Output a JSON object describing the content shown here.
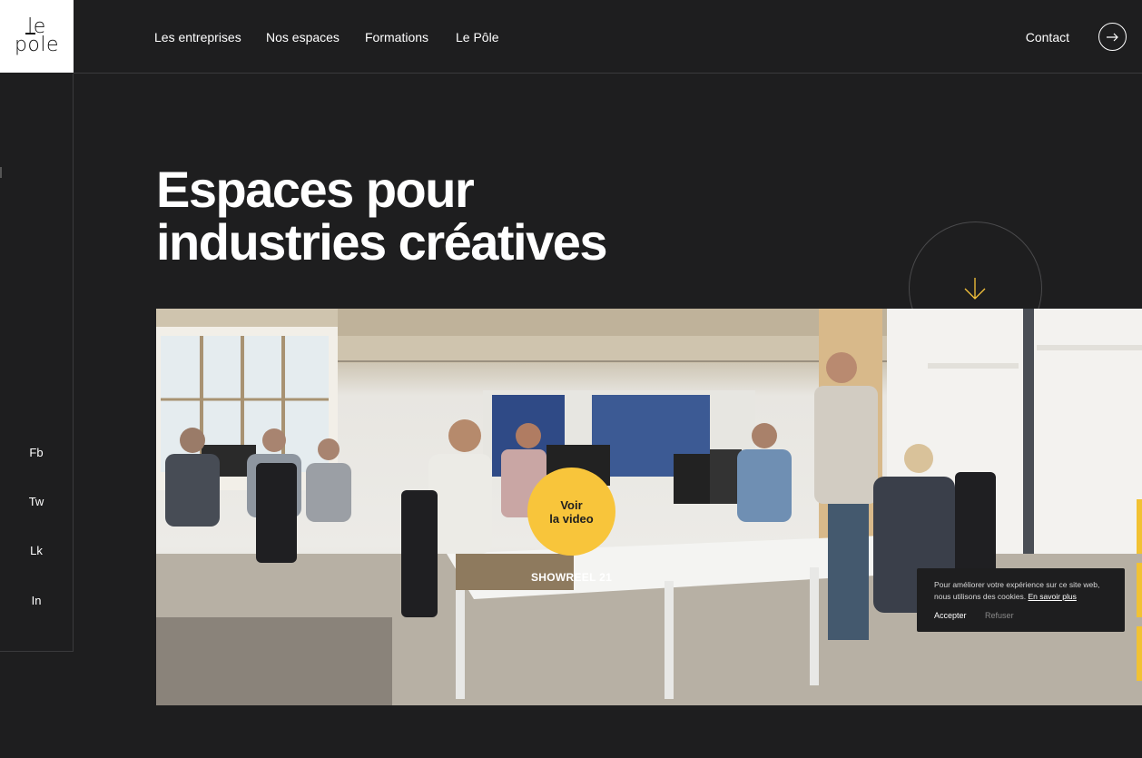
{
  "logo": {
    "line1": "le",
    "line2": "pole"
  },
  "nav": {
    "items": [
      "Les entreprises",
      "Nos espaces",
      "Formations",
      "Le Pôle"
    ],
    "contact": "Contact",
    "contact_icon": "arrow-right-icon"
  },
  "social": [
    "Fb",
    "Tw",
    "Lk",
    "In"
  ],
  "hero": {
    "title_line1": "Espaces pour",
    "title_line2": "industries créatives",
    "scroll_icon": "arrow-down-icon"
  },
  "video": {
    "button_line1": "Voir",
    "button_line2": "la video",
    "caption": "SHOWREEL 21"
  },
  "cookie": {
    "text": "Pour améliorer votre expérience sur ce site web, nous utilisons des cookies.",
    "link": "En savoir plus",
    "accept": "Accepter",
    "refuse": "Refuser"
  },
  "colors": {
    "background": "#1e1e1f",
    "accent": "#f8c53b",
    "logo_bg": "#ffffff"
  }
}
